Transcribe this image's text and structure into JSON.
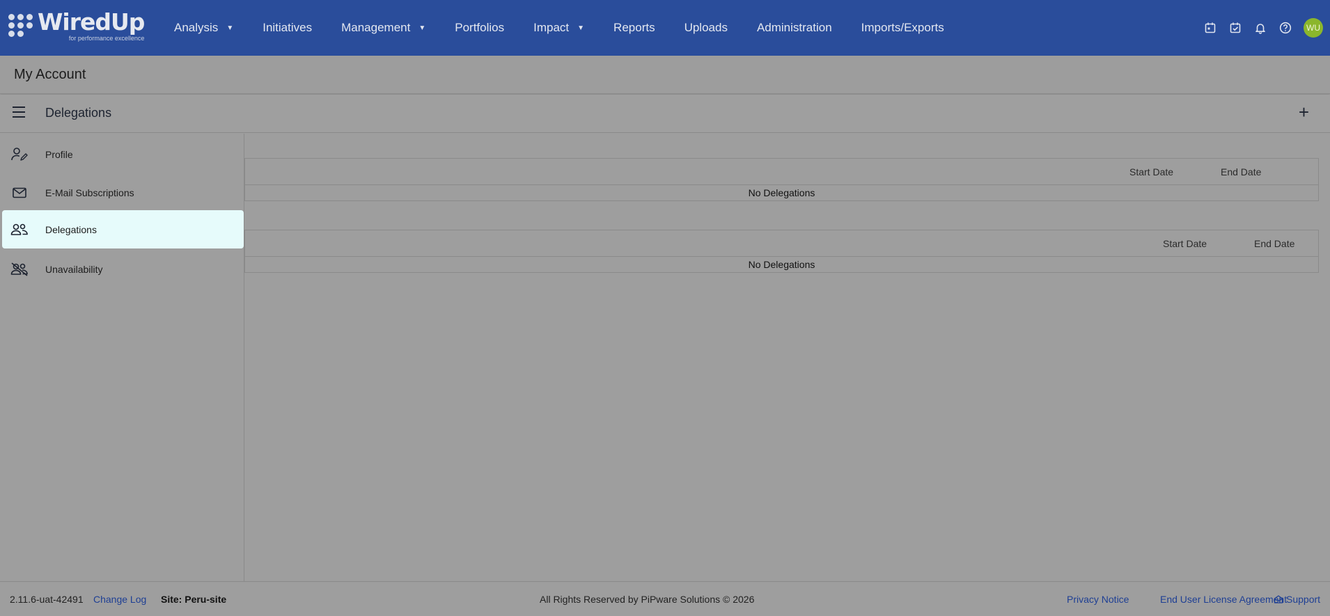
{
  "logo": {
    "title": "WiredUp",
    "tagline": "for performance excellence"
  },
  "nav": {
    "items": [
      {
        "label": "Analysis",
        "dropdown": true
      },
      {
        "label": "Initiatives",
        "dropdown": false
      },
      {
        "label": "Management",
        "dropdown": true
      },
      {
        "label": "Portfolios",
        "dropdown": false
      },
      {
        "label": "Impact",
        "dropdown": true
      },
      {
        "label": "Reports",
        "dropdown": false
      },
      {
        "label": "Uploads",
        "dropdown": false
      },
      {
        "label": "Administration",
        "dropdown": false
      },
      {
        "label": "Imports/Exports",
        "dropdown": false
      }
    ],
    "icons": [
      "calendar-icon",
      "calendar-check-icon",
      "bell-icon",
      "help-icon"
    ],
    "avatar_initials": "WU"
  },
  "account": {
    "title": "My Account"
  },
  "section": {
    "title": "Delegations"
  },
  "sidebar": {
    "items": [
      {
        "label": "Profile",
        "icon": "user-edit-icon",
        "active": false
      },
      {
        "label": "E-Mail Subscriptions",
        "icon": "mail-icon",
        "active": false
      },
      {
        "label": "Delegations",
        "icon": "users-icon",
        "active": true
      },
      {
        "label": "Unavailability",
        "icon": "users-off-icon",
        "active": false
      }
    ]
  },
  "tables": [
    {
      "start_label": "Start Date",
      "end_label": "End Date",
      "empty_text": "No Delegations"
    },
    {
      "start_label": "Start Date",
      "end_label": "End Date",
      "empty_text": "No Delegations"
    }
  ],
  "footer": {
    "version": "2.11.6-uat-42491",
    "changelog": "Change Log",
    "site": "Site: Peru-site",
    "copyright": "All Rights Reserved by PiPware Solutions © 2026",
    "privacy": "Privacy Notice",
    "eula": "End User License Agreement",
    "support": "Support"
  },
  "colors": {
    "nav_bg": "#2a4d9b",
    "active_item_bg": "#e6fbfb",
    "avatar_bg": "#8bb62c",
    "link": "#1e3f94"
  }
}
